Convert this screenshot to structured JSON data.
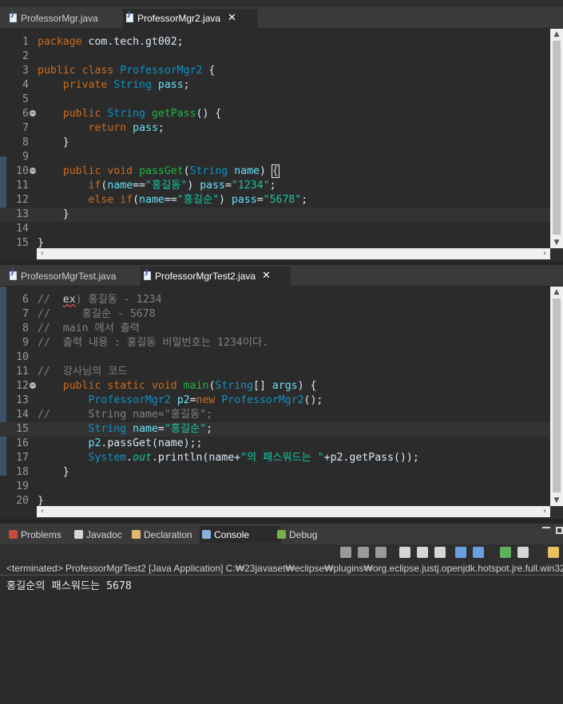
{
  "top_editor": {
    "tabs": [
      {
        "label": "ProfessorMgr.java"
      },
      {
        "label": "ProfessorMgr2.java",
        "active": true
      }
    ],
    "close_glyph": "✕",
    "lines": [
      {
        "n": "1",
        "tokens": [
          [
            "kw",
            "package"
          ],
          [
            "pl",
            " com.tech.gt002;"
          ]
        ]
      },
      {
        "n": "2",
        "tokens": []
      },
      {
        "n": "3",
        "tokens": [
          [
            "kw",
            "public"
          ],
          [
            "pl",
            " "
          ],
          [
            "kw",
            "class"
          ],
          [
            "pl",
            " "
          ],
          [
            "ty",
            "ProfessorMgr2"
          ],
          [
            "pl",
            " {"
          ]
        ]
      },
      {
        "n": "4",
        "tokens": [
          [
            "pl",
            "    "
          ],
          [
            "kw",
            "private"
          ],
          [
            "pl",
            " "
          ],
          [
            "ty",
            "String"
          ],
          [
            "pl",
            " "
          ],
          [
            "vr",
            "pass"
          ],
          [
            "pl",
            ";"
          ]
        ]
      },
      {
        "n": "5",
        "tokens": []
      },
      {
        "n": "6",
        "fold": true,
        "tokens": [
          [
            "pl",
            "    "
          ],
          [
            "kw",
            "public"
          ],
          [
            "pl",
            " "
          ],
          [
            "ty",
            "String"
          ],
          [
            "pl",
            " "
          ],
          [
            "fn",
            "getPass"
          ],
          [
            "pl",
            "() {"
          ]
        ]
      },
      {
        "n": "7",
        "tokens": [
          [
            "pl",
            "        "
          ],
          [
            "kw",
            "return"
          ],
          [
            "pl",
            " "
          ],
          [
            "vr",
            "pass"
          ],
          [
            "pl",
            ";"
          ]
        ]
      },
      {
        "n": "8",
        "tokens": [
          [
            "pl",
            "    }"
          ]
        ]
      },
      {
        "n": "9",
        "tokens": []
      },
      {
        "n": "10",
        "fold": true,
        "tokens": [
          [
            "pl",
            "    "
          ],
          [
            "kw",
            "public"
          ],
          [
            "pl",
            " "
          ],
          [
            "kw",
            "void"
          ],
          [
            "pl",
            " "
          ],
          [
            "fn",
            "passGet"
          ],
          [
            "pl",
            "("
          ],
          [
            "ty",
            "String"
          ],
          [
            "pl",
            " "
          ],
          [
            "vr",
            "name"
          ],
          [
            "pl",
            ") "
          ],
          [
            "brk",
            "{"
          ]
        ]
      },
      {
        "n": "11",
        "tokens": [
          [
            "pl",
            "        "
          ],
          [
            "kw",
            "if"
          ],
          [
            "pl",
            "("
          ],
          [
            "vr",
            "name"
          ],
          [
            "pl",
            "=="
          ],
          [
            "st",
            "\"홍길동\""
          ],
          [
            "pl",
            ") "
          ],
          [
            "vr",
            "pass"
          ],
          [
            "pl",
            "="
          ],
          [
            "st",
            "\"1234\""
          ],
          [
            "pl",
            ";"
          ]
        ]
      },
      {
        "n": "12",
        "tokens": [
          [
            "pl",
            "        "
          ],
          [
            "kw",
            "else"
          ],
          [
            "pl",
            " "
          ],
          [
            "kw",
            "if"
          ],
          [
            "pl",
            "("
          ],
          [
            "vr",
            "name"
          ],
          [
            "pl",
            "=="
          ],
          [
            "st",
            "\"홍길순\""
          ],
          [
            "pl",
            ") "
          ],
          [
            "vr",
            "pass"
          ],
          [
            "pl",
            "="
          ],
          [
            "st",
            "\"5678\""
          ],
          [
            "pl",
            ";"
          ]
        ]
      },
      {
        "n": "13",
        "current": true,
        "tokens": [
          [
            "pl",
            "    }"
          ]
        ]
      },
      {
        "n": "14",
        "tokens": []
      },
      {
        "n": "15",
        "tokens": [
          [
            "pl",
            "}"
          ]
        ]
      }
    ]
  },
  "bottom_editor": {
    "tabs": [
      {
        "label": "ProfessorMgrTest.java"
      },
      {
        "label": "ProfessorMgrTest2.java",
        "active": true
      }
    ],
    "close_glyph": "✕",
    "lines": [
      {
        "n": "6",
        "tokens": [
          [
            "cm",
            "//  "
          ],
          [
            "squig",
            "ex"
          ],
          [
            "cm",
            ") 홍길동 - 1234"
          ]
        ]
      },
      {
        "n": "7",
        "tokens": [
          [
            "cm",
            "//     홍길순 - 5678"
          ]
        ]
      },
      {
        "n": "8",
        "tokens": [
          [
            "cm",
            "//  main 에서 출력"
          ]
        ]
      },
      {
        "n": "9",
        "tokens": [
          [
            "cm",
            "//  출력 내용 : 홍길동 비밀번호는 1234이다."
          ]
        ]
      },
      {
        "n": "10",
        "tokens": []
      },
      {
        "n": "11",
        "tokens": [
          [
            "cm",
            "//  강사님의 코드"
          ]
        ]
      },
      {
        "n": "12",
        "fold": true,
        "tokens": [
          [
            "pl",
            "    "
          ],
          [
            "kw",
            "public"
          ],
          [
            "pl",
            " "
          ],
          [
            "kw",
            "static"
          ],
          [
            "pl",
            " "
          ],
          [
            "kw",
            "void"
          ],
          [
            "pl",
            " "
          ],
          [
            "fn",
            "main"
          ],
          [
            "pl",
            "("
          ],
          [
            "ty",
            "String"
          ],
          [
            "pl",
            "[] "
          ],
          [
            "vr",
            "args"
          ],
          [
            "pl",
            ") {"
          ]
        ]
      },
      {
        "n": "13",
        "tokens": [
          [
            "pl",
            "        "
          ],
          [
            "ty",
            "ProfessorMgr2"
          ],
          [
            "pl",
            " "
          ],
          [
            "vr",
            "p2"
          ],
          [
            "pl",
            "="
          ],
          [
            "kw",
            "new"
          ],
          [
            "pl",
            " "
          ],
          [
            "ty",
            "ProfessorMgr2"
          ],
          [
            "pl",
            "();"
          ]
        ]
      },
      {
        "n": "14",
        "tokens": [
          [
            "cm",
            "//      String name=\"홍길동\";"
          ]
        ]
      },
      {
        "n": "15",
        "current": true,
        "tokens": [
          [
            "pl",
            "        "
          ],
          [
            "ty",
            "String"
          ],
          [
            "pl",
            " "
          ],
          [
            "vr",
            "name"
          ],
          [
            "pl",
            "="
          ],
          [
            "st",
            "\"홍길순\""
          ],
          [
            "pl",
            ";"
          ]
        ]
      },
      {
        "n": "16",
        "tokens": [
          [
            "pl",
            "        "
          ],
          [
            "vr",
            "p2"
          ],
          [
            "pl",
            ".passGet(name);;"
          ]
        ]
      },
      {
        "n": "17",
        "tokens": [
          [
            "pl",
            "        "
          ],
          [
            "ty",
            "System"
          ],
          [
            "pl",
            "."
          ],
          [
            "st2",
            "out"
          ],
          [
            "pl",
            ".println(name+"
          ],
          [
            "st",
            "\"의 패스워드는 \""
          ],
          [
            "pl",
            "+p2.getPass());"
          ]
        ]
      },
      {
        "n": "18",
        "tokens": [
          [
            "pl",
            "    }"
          ]
        ]
      },
      {
        "n": "19",
        "tokens": []
      },
      {
        "n": "20",
        "tokens": [
          [
            "pl",
            "}"
          ]
        ]
      }
    ]
  },
  "console_panel": {
    "tabs": [
      {
        "label": "Problems",
        "icon": "problems-icon",
        "color": "#c84a3a"
      },
      {
        "label": "Javadoc",
        "icon": "javadoc-icon",
        "color": "#d8d8d8"
      },
      {
        "label": "Declaration",
        "icon": "declaration-icon",
        "color": "#e0b86a"
      },
      {
        "label": "Console",
        "icon": "console-icon",
        "color": "#8bb3e0",
        "active": true
      },
      {
        "label": "Debug",
        "icon": "debug-icon",
        "color": "#76b04a"
      }
    ],
    "header": "<terminated> ProfessorMgrTest2 [Java Application] C:₩23javaset₩eclipse₩plugins₩org.eclipse.justj.openjdk.hotspot.jre.full.win32.",
    "output": "홍길순의 패스워드는 5678",
    "toolbar_icons": [
      {
        "name": "terminate-icon",
        "color": "#9a9a9a"
      },
      {
        "name": "remove-launch-icon",
        "color": "#9a9a9a"
      },
      {
        "name": "remove-all-icon",
        "color": "#9a9a9a"
      },
      {
        "name": "scroll-lock-icon",
        "color": "#d6d6d6"
      },
      {
        "name": "word-wrap-icon",
        "color": "#d6d6d6"
      },
      {
        "name": "show-stdout-icon",
        "color": "#d6d6d6"
      },
      {
        "name": "pin-console-icon",
        "color": "#6aa0e0"
      },
      {
        "name": "show-stderr-icon",
        "color": "#6aa0e0"
      },
      {
        "name": "open-console-icon",
        "color": "#5fb05a"
      },
      {
        "name": "display-console-icon",
        "color": "#d6d6d6"
      },
      {
        "name": "new-console-icon",
        "color": "#e8c060"
      }
    ]
  }
}
